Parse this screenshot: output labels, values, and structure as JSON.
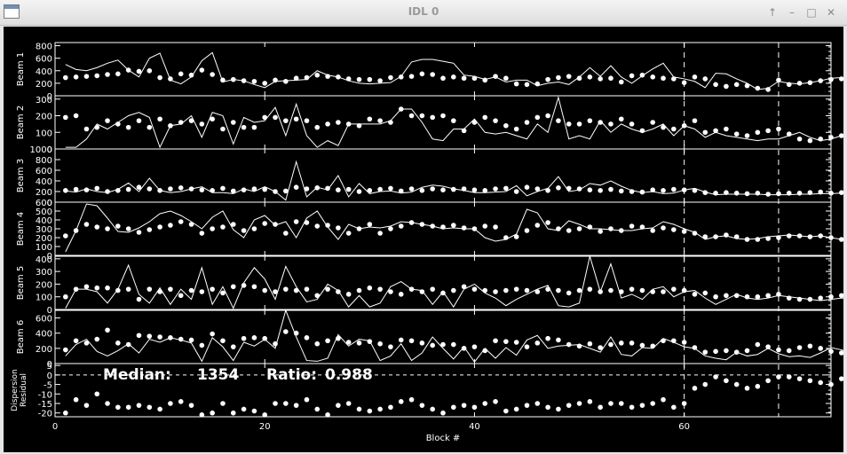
{
  "window": {
    "title": "IDL 0",
    "buttons": [
      {
        "name": "up-button",
        "glyph": "↑"
      },
      {
        "name": "minimize-button",
        "glyph": "–"
      },
      {
        "name": "maximize-button",
        "glyph": "□"
      },
      {
        "name": "close-button",
        "glyph": "✕"
      }
    ]
  },
  "chart_data": {
    "type": "scatter",
    "xlabel": "Block #",
    "xlim": [
      0,
      74
    ],
    "xticks": [
      0,
      20,
      40,
      60
    ],
    "vlines": [
      60,
      69
    ],
    "grid": false,
    "annotation": {
      "median_label": "Median:",
      "median_value": "1354",
      "ratio_label": "Ratio:",
      "ratio_value": "0.988"
    },
    "panels": [
      {
        "ylabel": "Beam 1",
        "ylim": [
          0,
          850
        ],
        "yticks": [
          0,
          200,
          400,
          600,
          800
        ],
        "points": [
          290,
          300,
          310,
          320,
          340,
          350,
          410,
          390,
          400,
          290,
          270,
          350,
          330,
          410,
          340,
          250,
          260,
          240,
          230,
          200,
          250,
          230,
          280,
          290,
          330,
          310,
          300,
          270,
          260,
          260,
          240,
          290,
          300,
          310,
          350,
          340,
          280,
          300,
          280,
          280,
          250,
          310,
          280,
          190,
          180,
          190,
          260,
          290,
          310,
          280,
          300,
          270,
          280,
          220,
          320,
          330,
          300,
          280,
          270,
          210,
          300,
          270,
          180,
          150,
          180,
          160,
          120,
          100,
          250,
          180,
          200,
          210,
          240,
          260,
          270,
          290,
          200,
          210,
          180
        ],
        "line": [
          500,
          420,
          400,
          450,
          520,
          570,
          410,
          300,
          600,
          680,
          250,
          190,
          300,
          560,
          690,
          220,
          260,
          240,
          180,
          130,
          230,
          240,
          250,
          260,
          400,
          330,
          300,
          240,
          200,
          190,
          200,
          210,
          310,
          540,
          580,
          580,
          550,
          520,
          330,
          310,
          260,
          300,
          220,
          250,
          250,
          160,
          200,
          220,
          180,
          300,
          450,
          310,
          480,
          300,
          200,
          320,
          430,
          520,
          300,
          270,
          230,
          130,
          360,
          350,
          270,
          200,
          100,
          120,
          230,
          200,
          190,
          210,
          240,
          280,
          290,
          240,
          200,
          210,
          180
        ]
      },
      {
        "ylabel": "Beam 2",
        "ylim": [
          0,
          320
        ],
        "yticks": [
          0,
          100,
          200,
          300
        ],
        "points": [
          190,
          200,
          120,
          130,
          170,
          150,
          130,
          170,
          130,
          180,
          140,
          160,
          170,
          150,
          180,
          120,
          160,
          130,
          130,
          190,
          190,
          170,
          180,
          170,
          130,
          150,
          160,
          150,
          140,
          180,
          170,
          160,
          240,
          200,
          200,
          190,
          200,
          170,
          110,
          160,
          190,
          170,
          140,
          120,
          160,
          190,
          200,
          170,
          150,
          150,
          170,
          160,
          150,
          180,
          150,
          110,
          160,
          130,
          120,
          140,
          170,
          100,
          110,
          120,
          90,
          80,
          100,
          110,
          120,
          90,
          60,
          50,
          60,
          70,
          80,
          100,
          130,
          120,
          100,
          110
        ],
        "line": [
          10,
          10,
          60,
          150,
          120,
          160,
          200,
          220,
          190,
          10,
          140,
          150,
          200,
          70,
          220,
          200,
          30,
          190,
          160,
          170,
          250,
          80,
          270,
          80,
          10,
          50,
          20,
          150,
          150,
          150,
          150,
          170,
          240,
          240,
          160,
          60,
          50,
          120,
          120,
          180,
          100,
          90,
          100,
          80,
          60,
          150,
          100,
          310,
          60,
          80,
          60,
          170,
          100,
          150,
          120,
          100,
          120,
          150,
          80,
          140,
          120,
          70,
          100,
          80,
          70,
          60,
          50,
          60,
          60,
          80,
          100,
          70,
          50,
          60,
          80,
          100,
          130,
          120,
          100,
          110
        ]
      },
      {
        "ylabel": "Beam 3",
        "ylim": [
          0,
          1000
        ],
        "yticks": [
          0,
          200,
          400,
          600,
          800,
          1000
        ],
        "points": [
          220,
          240,
          230,
          260,
          200,
          220,
          240,
          280,
          250,
          220,
          250,
          270,
          250,
          230,
          220,
          260,
          210,
          230,
          250,
          240,
          200,
          210,
          280,
          250,
          270,
          260,
          230,
          240,
          200,
          220,
          240,
          260,
          210,
          250,
          220,
          250,
          230,
          240,
          250,
          230,
          220,
          250,
          260,
          200,
          280,
          250,
          220,
          270,
          260,
          250,
          230,
          220,
          240,
          210,
          200,
          190,
          230,
          220,
          240,
          230,
          220,
          180,
          170,
          180,
          170,
          160,
          170,
          150,
          160,
          170,
          170,
          180,
          190,
          170,
          180,
          170,
          160,
          150,
          170
        ],
        "line": [
          210,
          190,
          250,
          200,
          180,
          240,
          360,
          200,
          450,
          220,
          180,
          200,
          250,
          290,
          180,
          180,
          160,
          250,
          200,
          290,
          200,
          40,
          760,
          100,
          280,
          230,
          500,
          100,
          350,
          160,
          200,
          210,
          170,
          190,
          280,
          320,
          300,
          250,
          220,
          180,
          180,
          190,
          200,
          310,
          120,
          200,
          260,
          480,
          200,
          230,
          350,
          320,
          400,
          300,
          220,
          180,
          200,
          160,
          170,
          230,
          260,
          190,
          140,
          150,
          150,
          150,
          150,
          140,
          140,
          140,
          150,
          150,
          160,
          160,
          170,
          160,
          150,
          150,
          160
        ]
      },
      {
        "ylabel": "Beam 4",
        "ylim": [
          0,
          600
        ],
        "yticks": [
          0,
          100,
          200,
          300,
          400,
          500,
          600
        ],
        "points": [
          220,
          280,
          350,
          320,
          300,
          330,
          300,
          260,
          290,
          320,
          340,
          380,
          350,
          250,
          300,
          320,
          350,
          280,
          300,
          360,
          350,
          250,
          380,
          370,
          330,
          340,
          310,
          250,
          300,
          350,
          250,
          300,
          330,
          370,
          350,
          330,
          320,
          340,
          310,
          300,
          330,
          320,
          200,
          210,
          280,
          340,
          370,
          300,
          280,
          300,
          320,
          270,
          300,
          280,
          330,
          320,
          280,
          310,
          290,
          270,
          250,
          210,
          210,
          230,
          210,
          180,
          180,
          190,
          200,
          220,
          220,
          210,
          220,
          200,
          180,
          200,
          190,
          190,
          180
        ],
        "line": [
          40,
          280,
          580,
          560,
          420,
          270,
          260,
          310,
          380,
          470,
          500,
          450,
          380,
          300,
          430,
          500,
          290,
          200,
          400,
          450,
          340,
          380,
          200,
          420,
          500,
          320,
          180,
          350,
          300,
          320,
          310,
          330,
          380,
          370,
          350,
          330,
          300,
          310,
          300,
          300,
          200,
          160,
          180,
          240,
          520,
          480,
          300,
          280,
          390,
          350,
          300,
          300,
          290,
          280,
          280,
          300,
          310,
          380,
          350,
          300,
          260,
          180,
          210,
          220,
          190,
          180,
          190,
          210,
          220,
          230,
          220,
          210,
          220,
          200,
          180,
          200,
          200,
          180,
          150
        ]
      },
      {
        "ylabel": "Beam 5",
        "ylim": [
          0,
          420
        ],
        "yticks": [
          0,
          100,
          200,
          300,
          400
        ],
        "points": [
          100,
          160,
          180,
          170,
          170,
          150,
          160,
          80,
          160,
          140,
          160,
          110,
          150,
          140,
          160,
          130,
          180,
          190,
          180,
          150,
          140,
          160,
          150,
          160,
          110,
          160,
          140,
          120,
          150,
          170,
          160,
          140,
          120,
          160,
          140,
          160,
          130,
          150,
          180,
          160,
          150,
          140,
          150,
          160,
          150,
          140,
          160,
          150,
          130,
          150,
          160,
          140,
          150,
          140,
          160,
          150,
          140,
          140,
          160,
          150,
          120,
          130,
          100,
          110,
          110,
          100,
          100,
          110,
          120,
          90,
          80,
          80,
          90,
          100,
          110,
          100,
          90,
          90,
          80
        ],
        "line": [
          10,
          160,
          160,
          140,
          50,
          160,
          350,
          120,
          50,
          170,
          40,
          160,
          80,
          330,
          40,
          180,
          10,
          210,
          330,
          240,
          80,
          340,
          180,
          60,
          80,
          200,
          150,
          20,
          110,
          20,
          50,
          180,
          220,
          160,
          150,
          40,
          140,
          20,
          160,
          200,
          130,
          90,
          30,
          80,
          120,
          160,
          190,
          30,
          20,
          50,
          430,
          140,
          360,
          90,
          120,
          80,
          160,
          180,
          100,
          140,
          150,
          90,
          40,
          80,
          120,
          90,
          80,
          90,
          110,
          100,
          90,
          80,
          70,
          80,
          90,
          80,
          70,
          70,
          60
        ]
      },
      {
        "ylabel": "Beam 6",
        "ylim": [
          0,
          700
        ],
        "yticks": [
          0,
          200,
          400,
          600
        ],
        "points": [
          180,
          300,
          270,
          320,
          440,
          270,
          250,
          370,
          360,
          350,
          340,
          320,
          310,
          240,
          390,
          300,
          220,
          330,
          340,
          330,
          260,
          420,
          400,
          340,
          260,
          300,
          330,
          280,
          270,
          290,
          260,
          220,
          310,
          300,
          270,
          240,
          250,
          250,
          200,
          220,
          170,
          300,
          290,
          280,
          220,
          270,
          330,
          310,
          250,
          230,
          260,
          210,
          250,
          270,
          270,
          240,
          230,
          300,
          300,
          280,
          210,
          150,
          160,
          170,
          150,
          170,
          250,
          220,
          180,
          170,
          210,
          230,
          200,
          160,
          140,
          150,
          170,
          170,
          160
        ],
        "line": [
          100,
          250,
          320,
          160,
          100,
          170,
          260,
          140,
          320,
          280,
          340,
          310,
          270,
          30,
          340,
          220,
          40,
          280,
          230,
          320,
          200,
          700,
          350,
          40,
          30,
          70,
          380,
          230,
          320,
          300,
          40,
          100,
          260,
          40,
          140,
          350,
          200,
          60,
          220,
          20,
          200,
          70,
          210,
          110,
          310,
          370,
          200,
          230,
          240,
          250,
          200,
          150,
          350,
          120,
          100,
          210,
          200,
          330,
          280,
          220,
          200,
          100,
          70,
          50,
          150,
          100,
          120,
          200,
          130,
          90,
          100,
          80,
          140,
          210,
          180,
          140,
          150,
          160,
          150
        ]
      },
      {
        "ylabel": "Dispersion Residual",
        "ylim": [
          -22,
          6
        ],
        "yticks": [
          5,
          0,
          -5,
          -10,
          -15,
          -20
        ],
        "hline": 0,
        "points": [
          -20,
          -13,
          -16,
          -10,
          -15,
          -17,
          -17,
          -16,
          -17,
          -18,
          -15,
          -14,
          -16,
          -21,
          -20,
          -15,
          -20,
          -18,
          -19,
          -21,
          -15,
          -15,
          -16,
          -13,
          -18,
          -21,
          -16,
          -15,
          -18,
          -19,
          -18,
          -17,
          -14,
          -13,
          -16,
          -18,
          -20,
          -17,
          -16,
          -17,
          -15,
          -14,
          -19,
          -18,
          -16,
          -15,
          -17,
          -18,
          -16,
          -15,
          -14,
          -17,
          -15,
          -15,
          -17,
          -16,
          -15,
          -13,
          -17,
          -15,
          -7,
          -5,
          -1,
          -3,
          -5,
          -7,
          -6,
          -3,
          -1,
          -1,
          -2,
          -3,
          -4,
          -5,
          -2,
          -1,
          -3,
          -1,
          -2
        ],
        "points_visible_from": 60,
        "points_visible_to": 68
      }
    ]
  }
}
